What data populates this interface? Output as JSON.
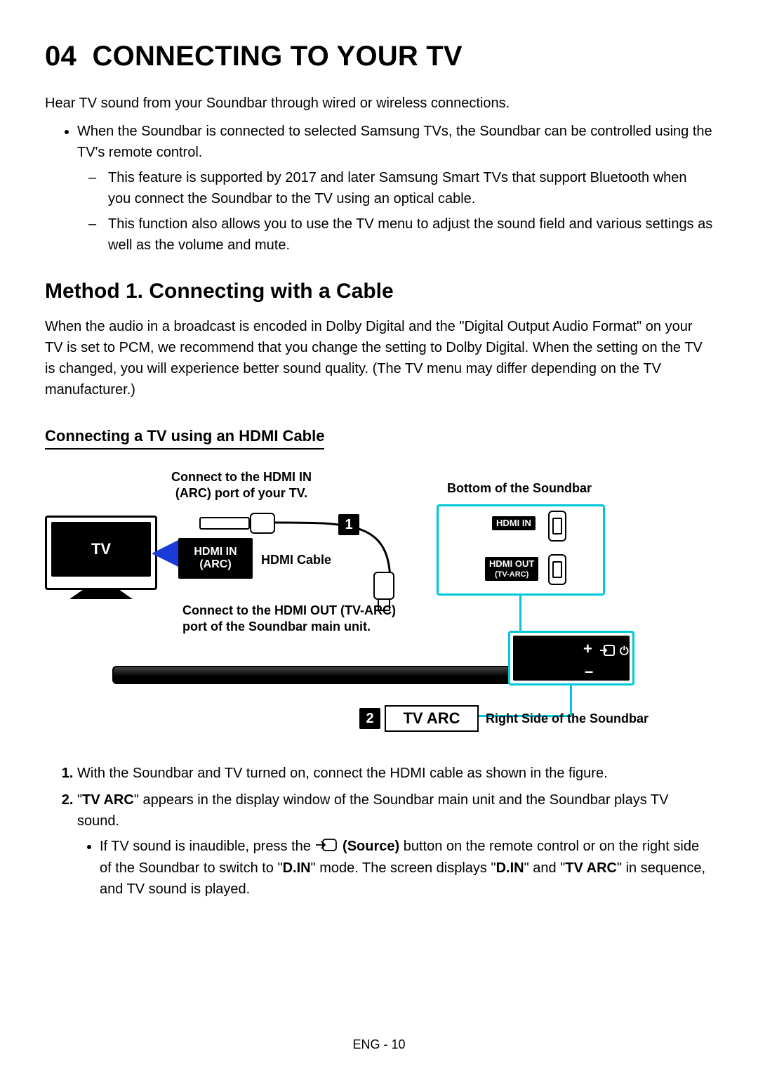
{
  "section_number": "04",
  "section_title": "CONNECTING TO YOUR TV",
  "intro": "Hear TV sound from your Soundbar through wired or wireless connections.",
  "bullet_main": "When the Soundbar is connected to selected Samsung TVs, the Soundbar can be controlled using the TV's remote control.",
  "dash1": "This feature is supported by 2017 and later Samsung Smart TVs that support Bluetooth when you connect the Soundbar to the TV using an optical cable.",
  "dash2": "This function also allows you to use the TV menu to adjust the sound field and various settings as well as the volume and mute.",
  "method_heading": "Method 1. Connecting with a Cable",
  "method_para": "When the audio in a broadcast is encoded in Dolby Digital and the \"Digital Output Audio Format\" on your TV is set to PCM, we recommend that you change the setting to Dolby Digital. When the setting on the TV is changed, you will experience better sound quality. (The TV menu may differ depending on the TV manufacturer.)",
  "sub_heading": "Connecting a TV using an HDMI Cable",
  "diagram": {
    "tv_label": "TV",
    "hdmi_in_arc_line1": "HDMI IN",
    "hdmi_in_arc_line2": "(ARC)",
    "connect_tv_line1": "Connect to the HDMI IN",
    "connect_tv_line2": "(ARC) port of your TV.",
    "hdmi_cable": "HDMI Cable",
    "bottom_label": "Bottom of the Soundbar",
    "port_hdmi_in": "HDMI IN",
    "port_hdmi_out_line1": "HDMI OUT",
    "port_hdmi_out_line2": "(TV-ARC)",
    "connect_soundbar_line1": "Connect to the HDMI OUT (TV-ARC)",
    "connect_soundbar_line2": "port of the Soundbar main unit.",
    "right_side": "Right Side of the Soundbar",
    "tv_arc": "TV ARC",
    "badge1": "1",
    "badge2": "2",
    "rp_plus": "+",
    "rp_minus": "–",
    "rp_power": "⏻"
  },
  "step1": "With the Soundbar and TV turned on, connect the HDMI cable as shown in the figure.",
  "step2_pre": "\"",
  "step2_bold1": "TV ARC",
  "step2_post1": "\" appears in the display window of the Soundbar main unit and the Soundbar plays TV sound.",
  "step2_sub_pre": "If TV sound is inaudible, press the ",
  "step2_sub_bold_source": "(Source)",
  "step2_sub_mid1": " button on the remote control or on the right side of the Soundbar to switch to \"",
  "step2_sub_bold_din1": "D.IN",
  "step2_sub_mid2": "\" mode. The screen displays \"",
  "step2_sub_bold_din2": "D.IN",
  "step2_sub_mid3": "\" and \"",
  "step2_sub_bold_tvarc": "TV ARC",
  "step2_sub_end": "\" in sequence, and TV sound is played.",
  "footer": "ENG - 10"
}
